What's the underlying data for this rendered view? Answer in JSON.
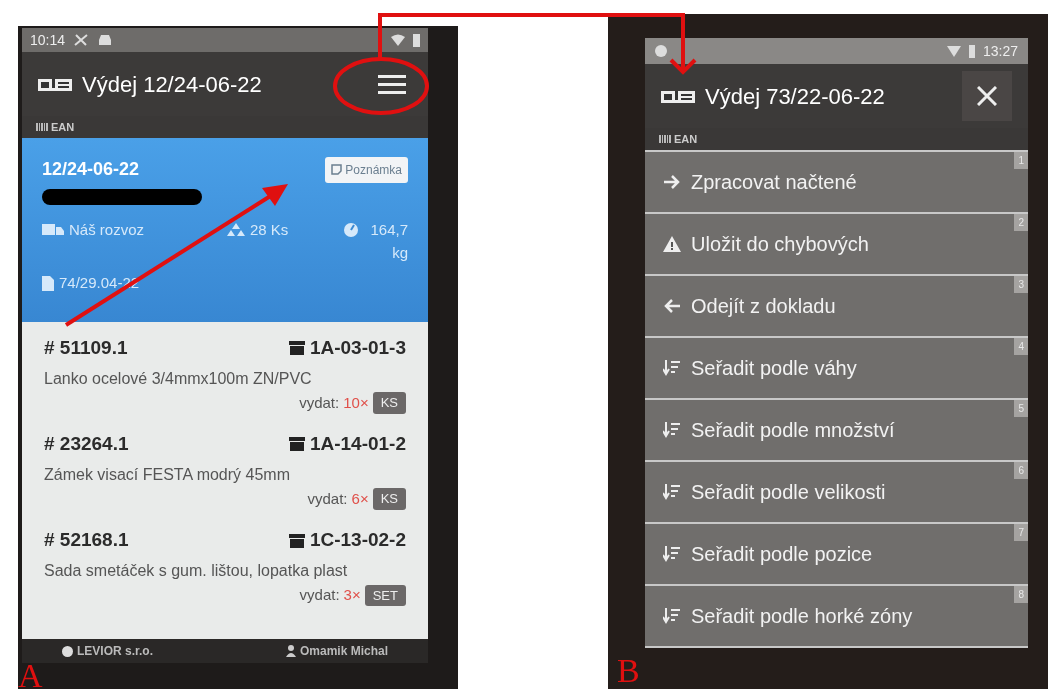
{
  "screen_a": {
    "label": "A",
    "status_bar": {
      "time": "10:14"
    },
    "title": "Výdej 12/24-06-22",
    "scan_mode": "EAN",
    "order": {
      "number": "12/24-06-22",
      "note_button": "Poznámka",
      "delivery": "Náš rozvoz",
      "pieces": "28 Ks",
      "weight": "164,7 kg",
      "document": "74/29.04-22"
    },
    "items": [
      {
        "code": "# 51109.1",
        "location": "1A-03-01-3",
        "name": "Lanko ocelové 3/4mmx100m ZN/PVC",
        "issue_label": "vydat:",
        "quantity": "10×",
        "unit": "KS"
      },
      {
        "code": "# 23264.1",
        "location": "1A-14-01-2",
        "name": "Zámek visací FESTA modrý 45mm",
        "issue_label": "vydat:",
        "quantity": "6×",
        "unit": "KS"
      },
      {
        "code": "# 52168.1",
        "location": "1C-13-02-2",
        "name": "Sada smetáček s gum. lištou, lopatka plast",
        "issue_label": "vydat:",
        "quantity": "3×",
        "unit": "SET"
      }
    ],
    "footer": {
      "company": "LEVIOR s.r.o.",
      "user": "Omamik Michal"
    }
  },
  "screen_b": {
    "label": "B",
    "status_bar": {
      "time": "13:27"
    },
    "title": "Výdej 73/22-06-22",
    "scan_mode": "EAN",
    "menu": [
      {
        "kind": "forward",
        "label": "Zpracovat načtené",
        "shortcut": "1"
      },
      {
        "kind": "warning",
        "label": "Uložit do chybových",
        "shortcut": "2"
      },
      {
        "kind": "back",
        "label": "Odejít z dokladu",
        "shortcut": "3"
      },
      {
        "kind": "sort",
        "label": "Seřadit podle váhy",
        "shortcut": "4"
      },
      {
        "kind": "sort",
        "label": "Seřadit podle množství",
        "shortcut": "5"
      },
      {
        "kind": "sort",
        "label": "Seřadit podle velikosti",
        "shortcut": "6"
      },
      {
        "kind": "sort",
        "label": "Seřadit podle pozice",
        "shortcut": "7"
      },
      {
        "kind": "sort",
        "label": "Seřadit podle horké zóny",
        "shortcut": "8"
      }
    ]
  }
}
